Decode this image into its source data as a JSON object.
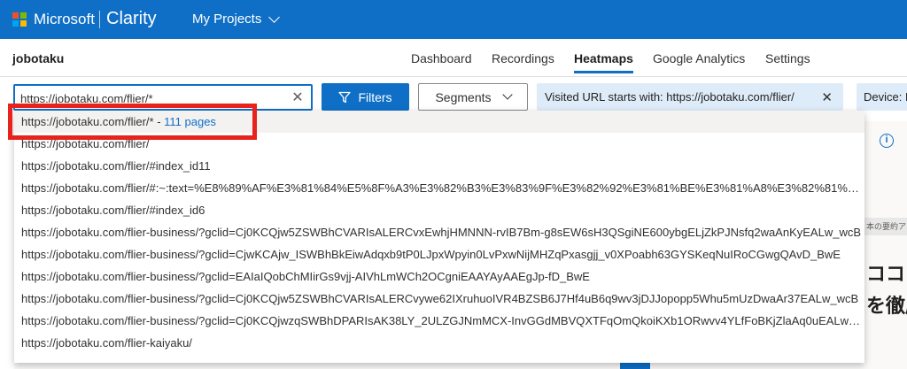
{
  "topbar": {
    "brand": "Microsoft",
    "product": "Clarity",
    "projects_label": "My Projects",
    "logo_colors": [
      "#f25022",
      "#7fba00",
      "#00a4ef",
      "#ffb900"
    ]
  },
  "header": {
    "project_name": "jobotaku",
    "nav": [
      {
        "label": "Dashboard",
        "active": false
      },
      {
        "label": "Recordings",
        "active": false
      },
      {
        "label": "Heatmaps",
        "active": true
      },
      {
        "label": "Google Analytics",
        "active": false
      },
      {
        "label": "Settings",
        "active": false
      }
    ]
  },
  "filter_bar": {
    "url_value": "https://jobotaku.com/flier/*",
    "filters_label": "Filters",
    "segments_label": "Segments",
    "chip_label": "Visited URL starts with: https://jobotaku.com/flier/",
    "chip2_label": "Device: M"
  },
  "dropdown": {
    "first": {
      "url": "https://jobotaku.com/flier/*",
      "separator": " - ",
      "count": "111 pages"
    },
    "items": [
      "https://jobotaku.com/flier/",
      "https://jobotaku.com/flier/#index_id11",
      "https://jobotaku.com/flier/#:~:text=%E8%89%AF%E3%81%84%E5%8F%A3%E3%82%B3%E3%83%9F%E3%82%92%E3%81%BE%E3%81%A8%E3%82%81%E3...",
      "https://jobotaku.com/flier/#index_id6",
      "https://jobotaku.com/flier-business/?gclid=Cj0KCQjw5ZSWBhCVARIsALERCvxEwhjHMNNN-rvIB7Bm-g8sEW6sH3QSgiNE600ybgELjZkPJNsfq2waAnKyEALw_wcB",
      "https://jobotaku.com/flier-business/?gclid=CjwKCAjw_ISWBhBkEiwAdqxb9tP0LJpxWpyin0LvPxwNijMHZqPxasgjj_v0XPoabh63GYSKeqNuIRoCGwgQAvD_BwE",
      "https://jobotaku.com/flier-business/?gclid=EAIaIQobChMIirGs9vjj-AIVhLmWCh2OCgniEAAYAyAAEgJp-fD_BwE",
      "https://jobotaku.com/flier-business/?gclid=Cj0KCQjw5ZSWBhCVARIsALERCvywe62IXruhuoIVR4BZSB6J7Hf4uB6q9wv3jDJJopopp5Whu5mUzDwaAr37EALw_wcB",
      "https://jobotaku.com/flier-business/?gclid=Cj0KCQjwzqSWBhDPARIsAK38LY_2ULZGJNmMCX-InvGGdMBVQXTFqOmQkoiKXb1ORwvv4YLfFoBKjZlaAq0uEALw_...",
      "https://jobotaku.com/flier-kaiyaku/"
    ]
  },
  "background": {
    "strip_text": "本の要約ア",
    "jp_line1": "ココミ",
    "jp_line2": "を徹底"
  },
  "colors": {
    "primary": "#0f6fc6",
    "chip_bg": "#deecf9",
    "highlight": "#e8231b"
  }
}
